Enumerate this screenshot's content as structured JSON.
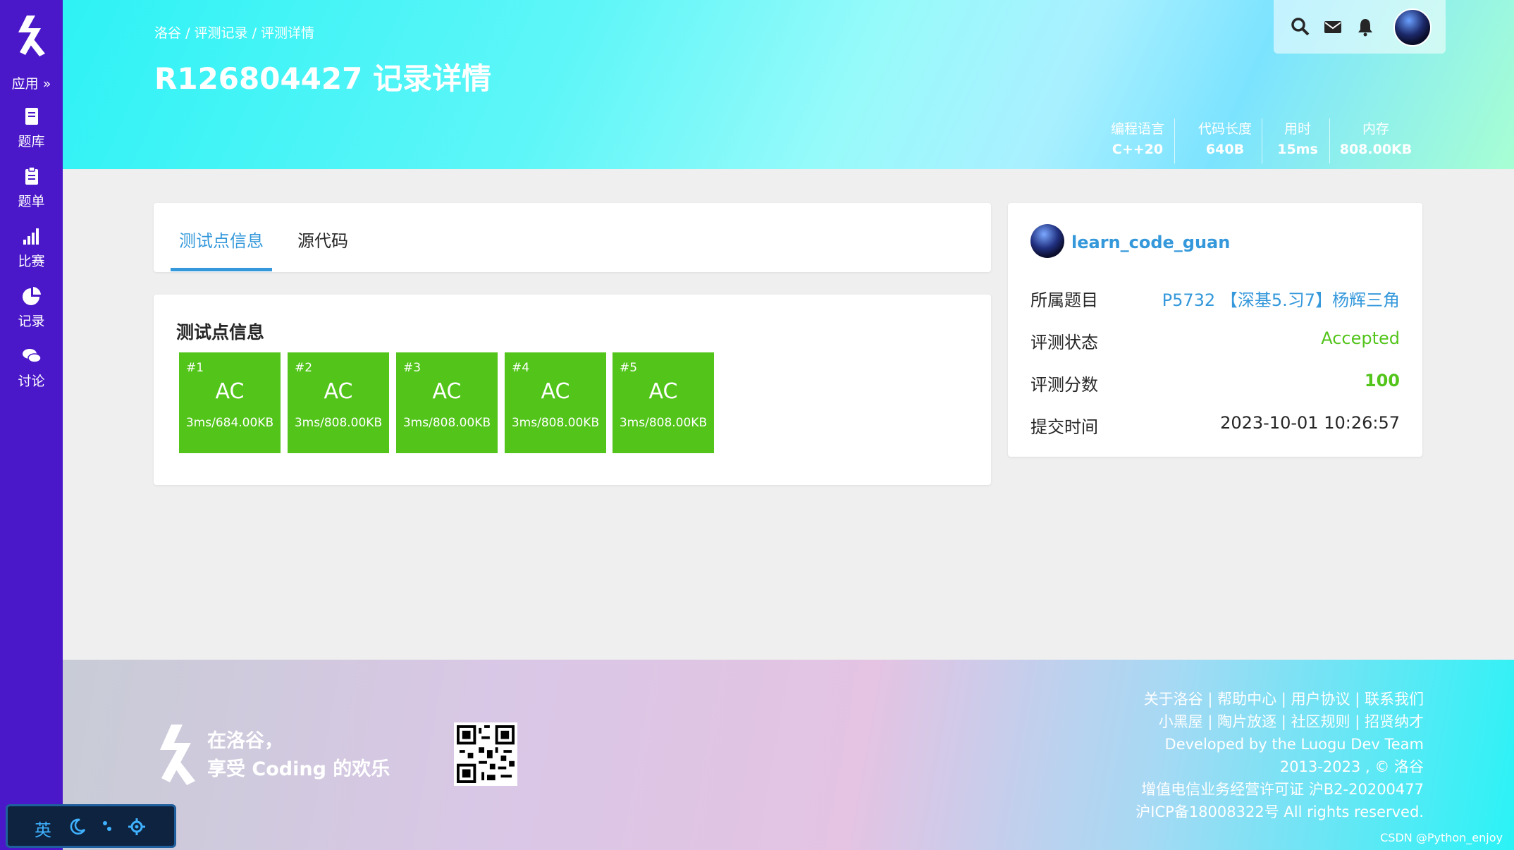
{
  "colors": {
    "sidebar": "#4a17c9",
    "accent": "#3498db",
    "ac_green": "#52c41a"
  },
  "sidebar": {
    "apps_label": "应用 »",
    "items": [
      {
        "label": "题库",
        "icon": "book-icon"
      },
      {
        "label": "题单",
        "icon": "clipboard-icon"
      },
      {
        "label": "比赛",
        "icon": "bar-chart-icon"
      },
      {
        "label": "记录",
        "icon": "pie-chart-icon"
      },
      {
        "label": "讨论",
        "icon": "chat-icon"
      }
    ]
  },
  "header": {
    "breadcrumb": [
      "洛谷",
      "评测记录",
      "评测详情"
    ],
    "breadcrumb_sep": "/",
    "title": "R126804427 记录详情",
    "stats": [
      {
        "key": "编程语言",
        "value": "C++20"
      },
      {
        "key": "代码长度",
        "value": "640B"
      },
      {
        "key": "用时",
        "value": "15ms"
      },
      {
        "key": "内存",
        "value": "808.00KB"
      }
    ]
  },
  "tabs": [
    {
      "label": "测试点信息",
      "active": true
    },
    {
      "label": "源代码",
      "active": false
    }
  ],
  "cases": {
    "title": "测试点信息",
    "items": [
      {
        "num": "#1",
        "status": "AC",
        "info": "3ms/684.00KB"
      },
      {
        "num": "#2",
        "status": "AC",
        "info": "3ms/808.00KB"
      },
      {
        "num": "#3",
        "status": "AC",
        "info": "3ms/808.00KB"
      },
      {
        "num": "#4",
        "status": "AC",
        "info": "3ms/808.00KB"
      },
      {
        "num": "#5",
        "status": "AC",
        "info": "3ms/808.00KB"
      }
    ]
  },
  "info": {
    "username": "learn_code_guan",
    "rows": [
      {
        "key": "所属题目",
        "value": "P5732 【深基5.习7】杨辉三角",
        "color": "#3498db"
      },
      {
        "key": "评测状态",
        "value": "Accepted",
        "color": "#52c41a"
      },
      {
        "key": "评测分数",
        "value": "100",
        "color": "#52c41a"
      },
      {
        "key": "提交时间",
        "value": "2023-10-01 10:26:57",
        "color": "#262626"
      }
    ]
  },
  "footer": {
    "slogan_line1": "在洛谷，",
    "slogan_line2": "享受 Coding 的欢乐",
    "links_row1": [
      "关于洛谷",
      "帮助中心",
      "用户协议",
      "联系我们"
    ],
    "links_row2": [
      "小黑屋",
      "陶片放逐",
      "社区规则",
      "招贤纳才"
    ],
    "dev_prefix": "Developed by the ",
    "dev_link": "Luogu Dev Team",
    "copyright": "2013-2023 , © 洛谷",
    "license": "增值电信业务经营许可证 沪B2-20200477",
    "icp": "沪ICP备18008322号 All rights reserved.",
    "watermark": "CSDN @Python_enjoy"
  },
  "ime": {
    "lang": "英",
    "items": [
      "moon-icon",
      "punct-icon",
      "gear-icon"
    ]
  }
}
